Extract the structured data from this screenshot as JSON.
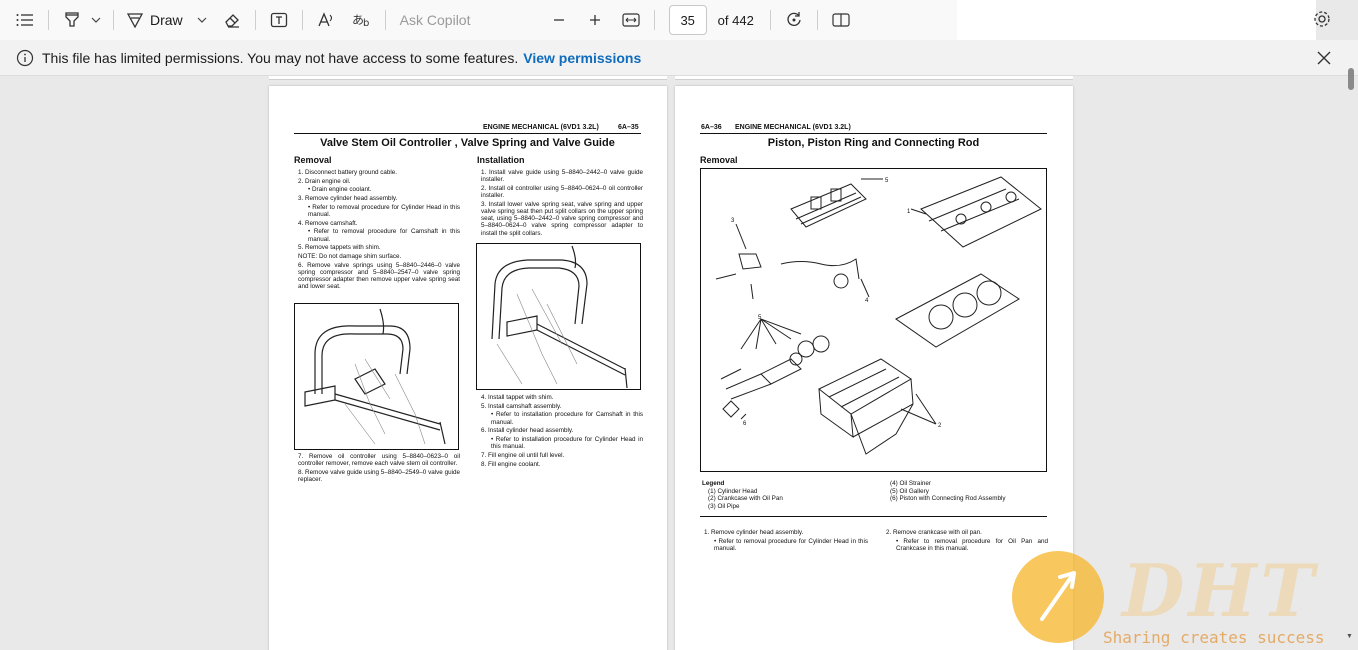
{
  "toolbar": {
    "icons": [
      "contents-icon",
      "highlight-icon",
      "chevron-down-icon",
      "draw-icon",
      "chevron-down-icon",
      "erase-icon",
      "text-icon",
      "read-aloud-icon",
      "translate-icon",
      "zoom-out-icon",
      "zoom-in-icon",
      "fit-width-icon",
      "rotate-icon",
      "page-view-icon",
      "settings-icon"
    ],
    "draw_label": "Draw",
    "ask_copilot": "Ask Copilot",
    "page_number": "35",
    "page_total": "of 442"
  },
  "infobar": {
    "message": "This file has limited permissions. You may not have access to some features.",
    "link": "View permissions"
  },
  "page1": {
    "header": "ENGINE MECHANICAL (6VD1 3.2L)",
    "page_num": "6A–35",
    "title": "Valve Stem Oil Controller , Valve Spring and Valve Guide",
    "removal_heading": "Removal",
    "installation_heading": "Installation",
    "removal_steps": [
      "1. Disconnect battery ground cable.",
      "2. Drain engine oil.",
      "• Drain engine coolant.",
      "3. Remove cylinder head assembly.",
      "• Refer to removal procedure for Cylinder Head in this manual.",
      "4. Remove camshaft.",
      "• Refer to removal procedure for Camshaft in this manual.",
      "5. Remove tappets with shim.",
      "NOTE: Do not damage shim surface.",
      "6. Remove valve springs using 5–8840–2446–0 valve spring compressor and 5–8840–2547–0 valve spring compressor adapter then remove upper valve spring seat and lower seat."
    ],
    "removal_steps_after": [
      "7. Remove oil controller using 5–8840–0623–0 oil controller remover, remove each valve stem oil controller.",
      "8. Remove valve guide using 5–8840–2549–0 valve guide replacer."
    ],
    "install_steps": [
      "1. Install valve guide using 5–8840–2442–0 valve guide installer.",
      "2. Install oil controller using 5–8840–0624–0 oil controller installer.",
      "3. Install lower valve spring seat, valve spring and upper valve spring seat then put split collars on the upper spring seat, using 5–8840–2442–0 valve spring compressor and 5–8840–0624–0 valve spring compressor adapter to install the split collars."
    ],
    "install_steps_after": [
      "4. Install tappet with shim.",
      "5. Install camshaft assembly.",
      "• Refer to installation procedure for Camshaft in this manual.",
      "6. Install cylinder head assembly.",
      "• Refer to installation procedure for Cylinder Head in this manual.",
      "7. Fill engine oil until full level.",
      "8. Fill engine coolant."
    ]
  },
  "page2": {
    "page_num": "6A–36",
    "header": "ENGINE MECHANICAL (6VD1 3.2L)",
    "title": "Piston, Piston Ring and Connecting Rod",
    "removal_heading": "Removal",
    "callouts": [
      "1",
      "2",
      "3",
      "4",
      "5",
      "6"
    ],
    "legend_title": "Legend",
    "legend_left": [
      "(1)  Cylinder Head",
      "(2)  Crankcase with Oil Pan",
      "(3)  Oil Pipe"
    ],
    "legend_right": [
      "(4)  Oil Strainer",
      "(5)  Oil Gallery",
      "(6)  Piston with Connecting Rod Assembly"
    ],
    "steps_left": [
      "1. Remove cylinder head assembly.",
      "• Refer to removal procedure for Cylinder Head in this manual."
    ],
    "steps_right": [
      "2. Remove crankcase with oil pan.",
      "• Refer to removal procedure for Oil Pan and Crankcase in this manual."
    ]
  },
  "watermark": {
    "logo": "DHT",
    "tagline": "Sharing creates success"
  }
}
